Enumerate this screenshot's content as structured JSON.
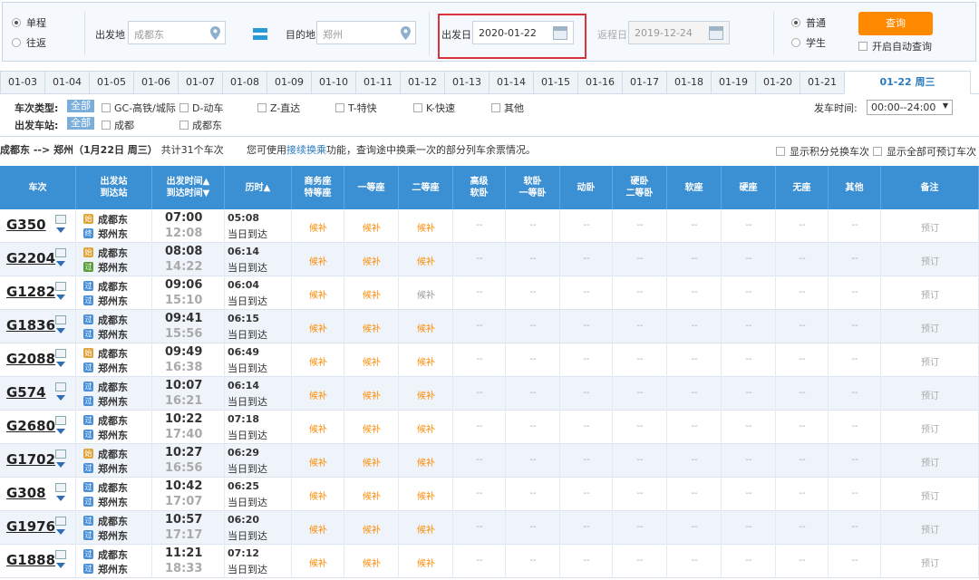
{
  "search": {
    "trip_types": [
      "单程",
      "往返"
    ],
    "from_label": "出发地",
    "from_value": "成都东",
    "to_label": "目的地",
    "to_value": "郑州",
    "depart_label": "出发日",
    "depart_value": "2020-01-22",
    "return_label": "返程日",
    "return_value": "2019-12-24",
    "passenger_types": [
      "普通",
      "学生"
    ],
    "query_button": "查询",
    "auto_query": "开启自动查询"
  },
  "date_tabs": [
    "01-03",
    "01-04",
    "01-05",
    "01-06",
    "01-07",
    "01-08",
    "01-09",
    "01-10",
    "01-11",
    "01-12",
    "01-13",
    "01-14",
    "01-15",
    "01-16",
    "01-17",
    "01-18",
    "01-19",
    "01-20",
    "01-21",
    "01-22 周三"
  ],
  "filters": {
    "train_type_label": "车次类型:",
    "all": "全部",
    "train_types": [
      "GC-高铁/城际",
      "D-动车",
      "Z-直达",
      "T-特快",
      "K-快速",
      "其他"
    ],
    "station_label": "出发车站:",
    "stations": [
      "成都",
      "成都东"
    ],
    "time_label": "发车时间:",
    "time_value": "00:00--24:00"
  },
  "summary": {
    "route": "成都东 --> 郑州（1月22日  周三）",
    "count": "共计31个车次",
    "tip_pre": "您可使用",
    "tip_link": "接续换乘",
    "tip_post": "功能，查询途中换乘一次的部分列车余票情况。",
    "opt1": "显示积分兑换车次",
    "opt2": "显示全部可预订车次"
  },
  "columns": [
    [
      "车次"
    ],
    [
      "出发站",
      "到达站"
    ],
    [
      "出发时间▲",
      "到达时间▼"
    ],
    [
      "历时▲"
    ],
    [
      "商务座",
      "特等座"
    ],
    [
      "一等座"
    ],
    [
      "二等座"
    ],
    [
      "高级",
      "软卧"
    ],
    [
      "软卧",
      "一等卧"
    ],
    [
      "动卧"
    ],
    [
      "硬卧",
      "二等卧"
    ],
    [
      "软座"
    ],
    [
      "硬座"
    ],
    [
      "无座"
    ],
    [
      "其他"
    ],
    [
      "备注"
    ]
  ],
  "colors": {
    "header": "#3b8fd3",
    "orange": "#ff8a00",
    "start_badge": "#e0a43c",
    "end_badge": "#4a90d9",
    "pass_badge": "#5a9e3a"
  },
  "dash": "--",
  "book_label": "预订",
  "same_day": "当日到达",
  "trains": [
    {
      "code": "G350",
      "from": "成都东",
      "to": "郑州东",
      "dep": "07:00",
      "arr": "12:08",
      "dur": "05:08",
      "from_badge": "始",
      "to_badge": "终",
      "seats": [
        "候补",
        "候补",
        "候补"
      ]
    },
    {
      "code": "G2204",
      "from": "成都东",
      "to": "郑州东",
      "dep": "08:08",
      "arr": "14:22",
      "dur": "06:14",
      "from_badge": "始",
      "to_badge": "过",
      "seats": [
        "候补",
        "候补",
        "候补"
      ]
    },
    {
      "code": "G1282",
      "from": "成都东",
      "to": "郑州东",
      "dep": "09:06",
      "arr": "15:10",
      "dur": "06:04",
      "from_badge": "过",
      "to_badge": "过",
      "seats": [
        "候补",
        "候补",
        "候补"
      ]
    },
    {
      "code": "G1836",
      "from": "成都东",
      "to": "郑州东",
      "dep": "09:41",
      "arr": "15:56",
      "dur": "06:15",
      "from_badge": "过",
      "to_badge": "过",
      "seats": [
        "候补",
        "候补",
        "候补"
      ]
    },
    {
      "code": "G2088",
      "from": "成都东",
      "to": "郑州东",
      "dep": "09:49",
      "arr": "16:38",
      "dur": "06:49",
      "from_badge": "始",
      "to_badge": "过",
      "seats": [
        "候补",
        "候补",
        "候补"
      ]
    },
    {
      "code": "G574",
      "from": "成都东",
      "to": "郑州东",
      "dep": "10:07",
      "arr": "16:21",
      "dur": "06:14",
      "from_badge": "过",
      "to_badge": "过",
      "seats": [
        "候补",
        "候补",
        "候补"
      ]
    },
    {
      "code": "G2680",
      "from": "成都东",
      "to": "郑州东",
      "dep": "10:22",
      "arr": "17:40",
      "dur": "07:18",
      "from_badge": "过",
      "to_badge": "过",
      "seats": [
        "候补",
        "候补",
        "候补"
      ]
    },
    {
      "code": "G1702",
      "from": "成都东",
      "to": "郑州东",
      "dep": "10:27",
      "arr": "16:56",
      "dur": "06:29",
      "from_badge": "始",
      "to_badge": "过",
      "seats": [
        "候补",
        "候补",
        "候补"
      ]
    },
    {
      "code": "G308",
      "from": "成都东",
      "to": "郑州东",
      "dep": "10:42",
      "arr": "17:07",
      "dur": "06:25",
      "from_badge": "过",
      "to_badge": "过",
      "seats": [
        "候补",
        "候补",
        "候补"
      ]
    },
    {
      "code": "G1976",
      "from": "成都东",
      "to": "郑州东",
      "dep": "10:57",
      "arr": "17:17",
      "dur": "06:20",
      "from_badge": "过",
      "to_badge": "过",
      "seats": [
        "候补",
        "候补",
        "候补"
      ]
    },
    {
      "code": "G1888",
      "from": "成都东",
      "to": "郑州东",
      "dep": "11:21",
      "arr": "18:33",
      "dur": "07:12",
      "from_badge": "过",
      "to_badge": "过",
      "seats": [
        "候补",
        "候补",
        "候补"
      ]
    }
  ]
}
